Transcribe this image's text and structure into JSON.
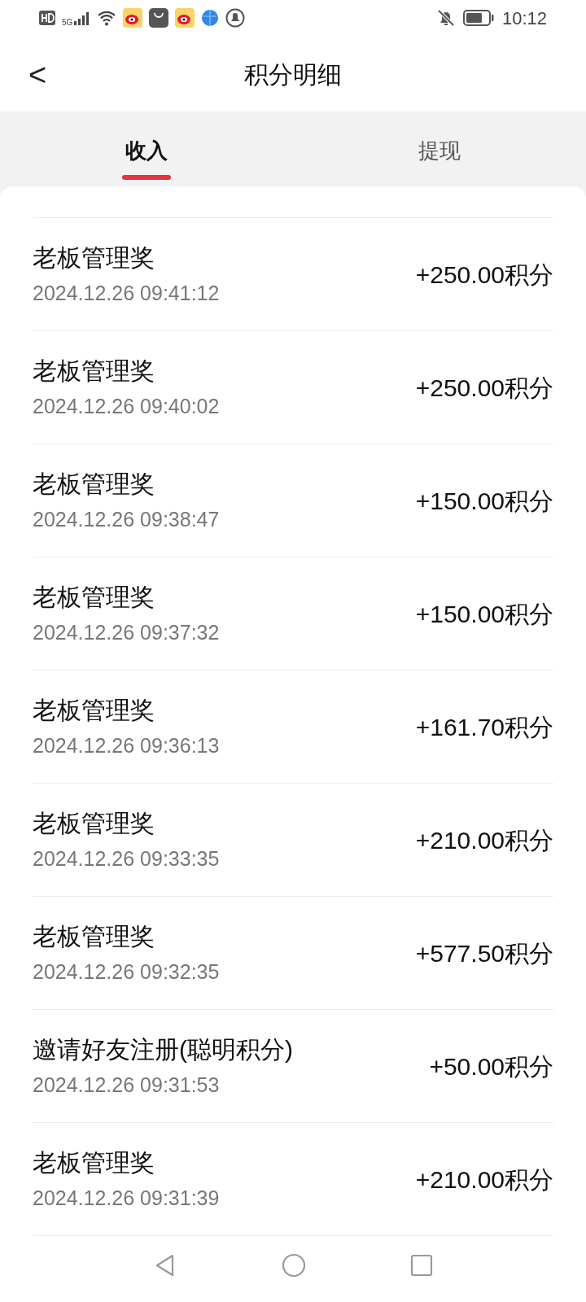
{
  "status_bar": {
    "network": "5G",
    "time": "10:12"
  },
  "header": {
    "back": "<",
    "title": "积分明细"
  },
  "tabs": [
    {
      "label": "收入",
      "selected": true
    },
    {
      "label": "提现",
      "selected": false
    }
  ],
  "records": [
    {
      "title": "老板管理奖",
      "time": "2024.12.26 09:41:12",
      "amount": "+250.00积分"
    },
    {
      "title": "老板管理奖",
      "time": "2024.12.26 09:40:02",
      "amount": "+250.00积分"
    },
    {
      "title": "老板管理奖",
      "time": "2024.12.26 09:38:47",
      "amount": "+150.00积分"
    },
    {
      "title": "老板管理奖",
      "time": "2024.12.26 09:37:32",
      "amount": "+150.00积分"
    },
    {
      "title": "老板管理奖",
      "time": "2024.12.26 09:36:13",
      "amount": "+161.70积分"
    },
    {
      "title": "老板管理奖",
      "time": "2024.12.26 09:33:35",
      "amount": "+210.00积分"
    },
    {
      "title": "老板管理奖",
      "time": "2024.12.26 09:32:35",
      "amount": "+577.50积分"
    },
    {
      "title": "邀请好友注册(聪明积分)",
      "time": "2024.12.26 09:31:53",
      "amount": "+50.00积分"
    },
    {
      "title": "老板管理奖",
      "time": "2024.12.26 09:31:39",
      "amount": "+210.00积分"
    }
  ]
}
